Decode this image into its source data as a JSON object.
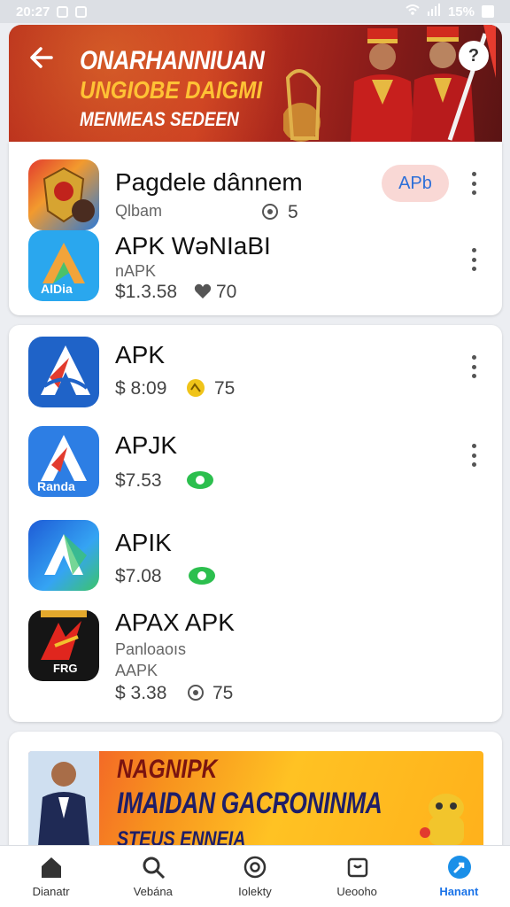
{
  "status_bar": {
    "time": "20:27",
    "battery": "15%"
  },
  "header": {
    "line1": "ONARHANNIUAN",
    "line2": "UNGIOBE DAIGMI",
    "line3": "MENMEAS SEDEEN"
  },
  "featured_apps": [
    {
      "name": "Pagdele dânnem",
      "sub": "Qlbam",
      "meta_icon": "eye-icon",
      "meta_value": "5",
      "badge": "APb"
    },
    {
      "name": "APK WəNIaBI",
      "sub": "nAPK",
      "price": "$1.3.58",
      "meta_icon": "heart-icon",
      "meta_value": "70",
      "icon_text": "AIDia"
    }
  ],
  "app_list": [
    {
      "name": "APK",
      "price": "$ 8:09",
      "meta_icon": "yellow-badge-icon",
      "meta_value": "75"
    },
    {
      "name": "APJK",
      "price": "$7.53",
      "meta_icon": "green-badge-icon",
      "icon_text": "Randa"
    },
    {
      "name": "APIK",
      "price": "$7.08",
      "meta_icon": "green-badge-icon"
    },
    {
      "name": "APAX APK",
      "sub1": "Panloaoıs",
      "sub2": "AAPK",
      "price": "$ 3.38",
      "meta_icon": "eye-icon",
      "meta_value": "75",
      "icon_text": "FRG"
    }
  ],
  "promo": {
    "line1": "NAGNIPK",
    "line2": "IMAIDAN GACRONINMA",
    "line3": "STEUS ENNEIA"
  },
  "bottom_nav": [
    {
      "label": "Dianatr",
      "icon": "home-icon"
    },
    {
      "label": "Vebána",
      "icon": "search-icon"
    },
    {
      "label": "Iolekty",
      "icon": "target-icon"
    },
    {
      "label": "Ueooho",
      "icon": "box-icon"
    },
    {
      "label": "Hanant",
      "icon": "compass-icon",
      "active": true
    }
  ],
  "colors": {
    "accent": "#1a73e8",
    "header_red": "#c8331f",
    "pill_bg": "#f9d8d5"
  }
}
